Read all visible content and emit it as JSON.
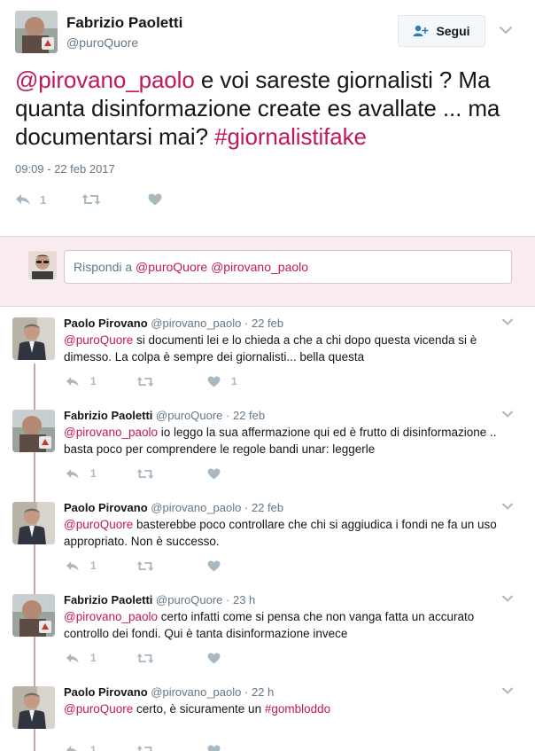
{
  "main_tweet": {
    "name": "Fabrizio Paoletti",
    "handle": "@puroQuore",
    "follow_label": "Segui",
    "text_parts": {
      "mention": "@pirovano_paolo",
      "text": " e voi sareste giornalisti ? Ma quanta disinformazione create es avallate ... ma documentarsi mai? ",
      "hashtag": "#giornalistifake"
    },
    "timestamp": "09:09 - 22 feb 2017",
    "reply_count": "1",
    "retweet_count": "",
    "like_count": ""
  },
  "reply_box": {
    "label": "Rispondi a ",
    "mention1": "@puroQuore",
    "mention2": "@pirovano_paolo"
  },
  "replies": [
    {
      "name": "Paolo Pirovano",
      "handle": "@pirovano_paolo",
      "dot": "·",
      "time": "22 feb",
      "mention": "@puroQuore",
      "text": " si documenti lei e lo chieda a che a chi dopo questa vicenda si è dimesso. La colpa è sempre dei giornalisti... bella questa",
      "hashtag": "",
      "reply_count": "1",
      "like_count": "1"
    },
    {
      "name": "Fabrizio Paoletti",
      "handle": "@puroQuore",
      "dot": "·",
      "time": "22 feb",
      "mention": "@pirovano_paolo",
      "text": " io leggo la sua affermazione qui ed è frutto di disinformazione .. basta poco per comprendere le regole bandi unar: leggerle",
      "hashtag": "",
      "reply_count": "1",
      "like_count": ""
    },
    {
      "name": "Paolo Pirovano",
      "handle": "@pirovano_paolo",
      "dot": "·",
      "time": "22 feb",
      "mention": "@puroQuore",
      "text": " basterebbe poco controllare che chi si aggiudica i fondi ne fa un uso appropriato. Non è successo.",
      "hashtag": "",
      "reply_count": "1",
      "like_count": ""
    },
    {
      "name": "Fabrizio Paoletti",
      "handle": "@puroQuore",
      "dot": "·",
      "time": "23 h",
      "mention": "@pirovano_paolo",
      "text": " certo infatti come si pensa che non vanga fatta un accurato controllo dei fondi. Qui è tanta disinformazione invece",
      "hashtag": "",
      "reply_count": "1",
      "like_count": ""
    },
    {
      "name": "Paolo Pirovano",
      "handle": "@pirovano_paolo",
      "dot": "·",
      "time": "22 h",
      "mention": "@puroQuore",
      "text": " certo, è sicuramente un ",
      "hashtag": "#gombloddo",
      "reply_count": "1",
      "like_count": ""
    }
  ],
  "colors": {
    "accent": "#c2185b",
    "reply_bar_bg": "#f9ecef",
    "thread_line": "#cfa0ad",
    "icon_gray": "#aab8c2"
  }
}
